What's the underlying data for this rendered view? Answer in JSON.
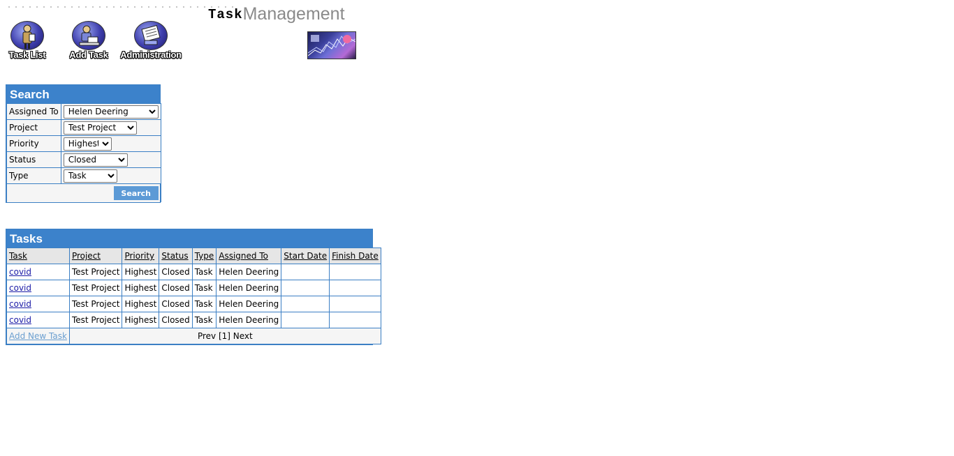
{
  "header": {
    "logo_ta": "Task",
    "logo_mg": "Management",
    "nav": [
      {
        "label": "Task List",
        "icon": "task-list-icon"
      },
      {
        "label": "Add Task",
        "icon": "add-task-icon"
      },
      {
        "label": "Administration",
        "icon": "administration-icon"
      }
    ]
  },
  "search": {
    "title": "Search",
    "fields": [
      {
        "label": "Assigned To",
        "value": "Helen Deering"
      },
      {
        "label": "Project",
        "value": "Test Project"
      },
      {
        "label": "Priority",
        "value": "Highest"
      },
      {
        "label": "Status",
        "value": "Closed"
      },
      {
        "label": "Type",
        "value": "Task"
      }
    ],
    "button": "Search"
  },
  "tasks": {
    "title": "Tasks",
    "columns": [
      "Task",
      "Project",
      "Priority",
      "Status",
      "Type",
      "Assigned To",
      "Start Date",
      "Finish Date"
    ],
    "rows": [
      [
        "covid",
        "Test Project",
        "Highest",
        "Closed",
        "Task",
        "Helen Deering",
        "",
        ""
      ],
      [
        "covid",
        "Test Project",
        "Highest",
        "Closed",
        "Task",
        "Helen Deering",
        "",
        ""
      ],
      [
        "covid",
        "Test Project",
        "Highest",
        "Closed",
        "Task",
        "Helen Deering",
        "",
        ""
      ],
      [
        "covid",
        "Test Project",
        "Highest",
        "Closed",
        "Task",
        "Helen Deering",
        "",
        ""
      ]
    ],
    "add_new": "Add New Task",
    "pager": {
      "prev": "Prev",
      "pages": "[1]",
      "next": "Next"
    }
  }
}
